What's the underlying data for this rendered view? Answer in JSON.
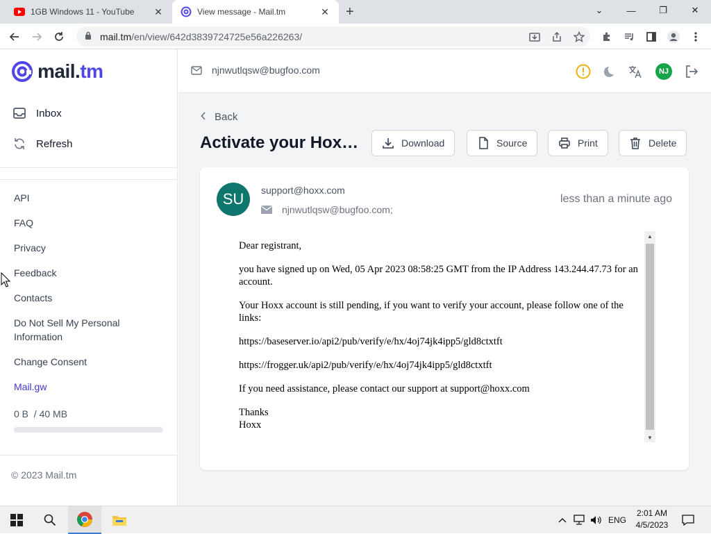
{
  "browser": {
    "tabs": [
      {
        "title": "1GB Windows 11 - YouTube",
        "icon": "youtube-icon"
      },
      {
        "title": "View message - Mail.tm",
        "icon": "mailtm-icon"
      }
    ],
    "url_domain": "mail.tm",
    "url_path": "/en/view/642d3839724725e56a226263/"
  },
  "app": {
    "logo_main": "mail.",
    "logo_tm": "tm",
    "account_email": "njnwutlqsw@bugfoo.com",
    "avatar_initials": "NJ",
    "accent_color": "#4f46e5"
  },
  "sidebar": {
    "actions": [
      {
        "label": "Inbox"
      },
      {
        "label": "Refresh"
      }
    ],
    "links": [
      {
        "label": "API"
      },
      {
        "label": "FAQ"
      },
      {
        "label": "Privacy"
      },
      {
        "label": "Feedback"
      },
      {
        "label": "Contacts"
      },
      {
        "label": "Do Not Sell My Personal Information"
      },
      {
        "label": "Change Consent"
      },
      {
        "label": "Mail.gw"
      }
    ],
    "storage_used": "0 B",
    "storage_total": "/ 40 MB",
    "storage_fraction": 0,
    "copyright": "© 2023 Mail.tm"
  },
  "message": {
    "back_label": "Back",
    "subject": "Activate your Hoxx...",
    "buttons": {
      "download": "Download",
      "source": "Source",
      "print": "Print",
      "delete": "Delete"
    },
    "sender_initials": "SU",
    "from": "support@hoxx.com",
    "to": "njnwutlqsw@bugfoo.com;",
    "time_ago": "less than a minute ago",
    "body": [
      "Dear registrant,",
      "you have signed up on Wed, 05 Apr 2023 08:58:25 GMT from the IP Address 143.244.47.73 for an account.",
      "Your Hoxx account is still pending, if you want to verify your account, please follow one of the links:",
      "https://baseserver.io/api2/pub/verify/e/hx/4oj74jk4ipp5/gld8ctxtft",
      "https://frogger.uk/api2/pub/verify/e/hx/4oj74jk4ipp5/gld8ctxtft",
      "If you need assistance, please contact our support at support@hoxx.com",
      "Thanks",
      "Hoxx"
    ]
  },
  "taskbar": {
    "lang": "ENG",
    "time": "2:01 AM",
    "date": "4/5/2023"
  }
}
